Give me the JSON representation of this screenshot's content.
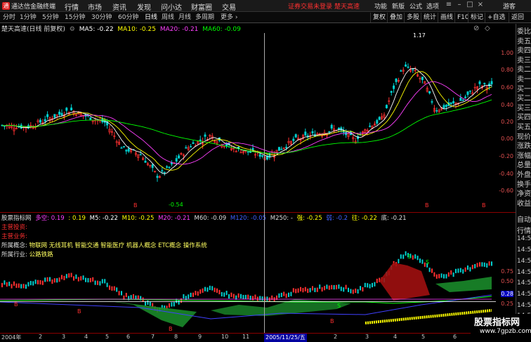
{
  "app": {
    "title": "通达信金融终端",
    "logo": "通"
  },
  "menu": [
    "行情",
    "市场",
    "资讯",
    "发现",
    "问小达",
    "财富圈",
    "交易"
  ],
  "login_notice": "证券交易未登录",
  "stock_short": "楚天高速",
  "right_menu": [
    "功能",
    "新版",
    "公式",
    "选项"
  ],
  "guest": "游客",
  "periods": [
    "分时",
    "1分钟",
    "5分钟",
    "15分钟",
    "30分钟",
    "60分钟",
    "日线",
    "周线",
    "月线",
    "多周期",
    "更多 ›"
  ],
  "active_period": "日线",
  "tools": [
    "复权",
    "叠加",
    "多股",
    "统计",
    "画线",
    "F10",
    "标记",
    "+自选",
    "返回"
  ],
  "main_info": {
    "name": "楚天高速(日线 前复权)",
    "ma5": "MA5: -0.22",
    "ma10": "MA10: -0.25",
    "ma20": "MA20: -0.21",
    "ma60": "MA60: -0.09"
  },
  "price_axis": [
    "1.00",
    "0.80",
    "0.60",
    "0.40",
    "0.20",
    "0.00",
    "-0.20",
    "-0.40",
    "-0.60"
  ],
  "peak_label": "1.17",
  "low_label": "-0.54",
  "ind_info": {
    "name": "股票指标网",
    "duokong": "多空: 0.19",
    "v": ": 0.19",
    "m5": "M5: -0.22",
    "m10": "M10: -0.25",
    "m20": "M20: -0.21",
    "m60": "M60: -0.09",
    "m120": "M120: -0.05",
    "m250": "M250: -",
    "qiang": "强: -0.25",
    "ruo": "弱: -0.2",
    "wang": "往: -0.22",
    "di": "底: -0.21"
  },
  "concepts": {
    "main_investor": "主营投资:",
    "main_business": "主营业务:",
    "concept_label": "所属概念:",
    "concept_text": "物联网 无线耳机 智能交通 智能医疗 机器人概念 ETC概念 操作系统",
    "industry_label": "所属行业:",
    "industry_text": "公路铁路"
  },
  "ind_axis": [
    "0.75",
    "0.50",
    "0.28",
    "0.25"
  ],
  "right_panel": [
    "委比",
    "卖五",
    "卖四",
    "卖三",
    "卖二",
    "卖一",
    "买一",
    "买二",
    "买三",
    "买四",
    "买五",
    "现价",
    "涨跌",
    "涨幅",
    "总量",
    "外盘",
    "换手",
    "净资",
    "收益",
    "自动",
    "行情",
    "14:50",
    "14:50",
    "14:50",
    "14:50",
    "14:50",
    "14:50",
    "14:50",
    "14:50"
  ],
  "timeline": [
    "2004年",
    "2",
    "3",
    "4",
    "5",
    "6",
    "7",
    "8",
    "9",
    "10",
    "11",
    "12",
    "2",
    "3",
    "4",
    "5",
    "6"
  ],
  "cursor_date": "2005/11/25/五",
  "watermark": {
    "title": "股票指标网",
    "url": "www.7gpzb.com"
  },
  "colors": {
    "up": "#ff3030",
    "down": "#00d0d0",
    "ma5": "#ffffff",
    "ma10": "#ffff00",
    "ma20": "#ff40ff",
    "ma60": "#00ff00"
  }
}
